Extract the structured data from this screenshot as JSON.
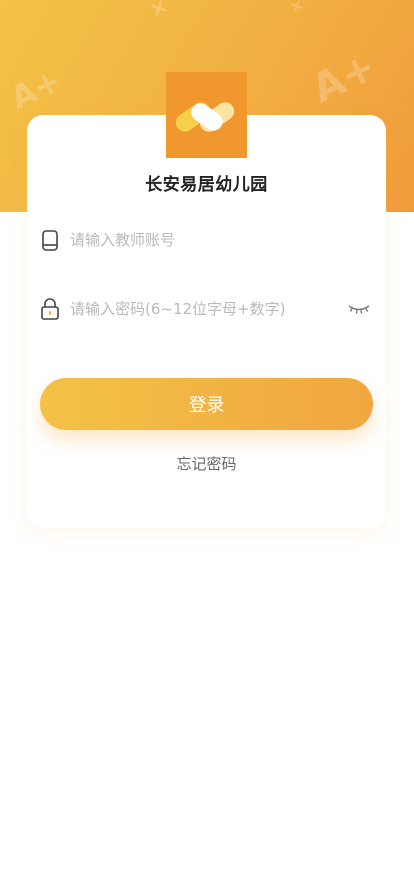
{
  "header": {
    "school_name": "长安易居幼儿园"
  },
  "form": {
    "account_placeholder": "请输入教师账号",
    "password_placeholder": "请输入密码(6~12位字母+数字)"
  },
  "actions": {
    "login_label": "登录",
    "forgot_label": "忘记密码"
  },
  "icons": {
    "logo": "app-logo-icon",
    "phone": "phone-icon",
    "lock": "lock-icon",
    "eye": "eye-closed-icon"
  },
  "colors": {
    "accent_start": "#f3c246",
    "accent_end": "#f09b3c",
    "logo_bg": "#f0982e"
  }
}
